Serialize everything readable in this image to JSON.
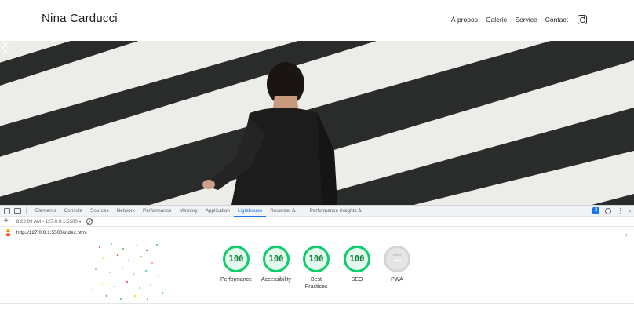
{
  "site": {
    "title": "Nina Carducci",
    "nav": [
      "À propos",
      "Galerie",
      "Service",
      "Contact"
    ],
    "social_icon": "instagram-icon"
  },
  "hero": {
    "prev_icon": "chevron-left-icon",
    "next_icon": "chevron-right-icon"
  },
  "devtools": {
    "tabs": [
      "Elements",
      "Console",
      "Sources",
      "Network",
      "Performance",
      "Memory",
      "Application",
      "Lighthouse",
      "Recorder Δ",
      "Performance insights Δ"
    ],
    "active_tab": "Lighthouse",
    "issues_count": "2",
    "report_time": "8:22:09 AM - 127.0.0.1:5500 ▾",
    "url": "http://127.0.0.1:5500/index.html"
  },
  "lighthouse": {
    "scores": [
      {
        "label": "Performance",
        "value": "100"
      },
      {
        "label": "Accessibility",
        "value": "100"
      },
      {
        "label": "Best Practices",
        "value": "100"
      },
      {
        "label": "SEO",
        "value": "100"
      }
    ],
    "pwa": {
      "label": "PWA",
      "badge": "PWA"
    }
  },
  "colors": {
    "score_green": "#0cce6b",
    "active_tab_blue": "#1a73e8",
    "pwa_gray": "#e5e5e5"
  }
}
